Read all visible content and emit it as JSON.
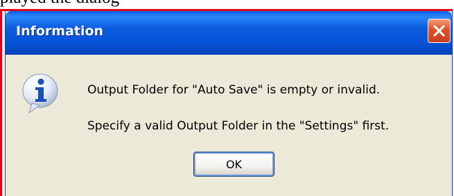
{
  "caption_fragment": "played the dialog",
  "dialog": {
    "title": "Information",
    "message_line_1": "Output Folder for \"Auto Save\" is empty or invalid.",
    "message_line_2": "Specify a valid Output Folder in the \"Settings\" first.",
    "ok_label": "OK"
  },
  "icons": {
    "close": "close-icon",
    "info": "information-icon"
  },
  "colors": {
    "title_bar": "#0655d8",
    "close_button": "#e0532b",
    "dialog_background": "#ece9d8",
    "highlight_border": "#e3001b"
  }
}
